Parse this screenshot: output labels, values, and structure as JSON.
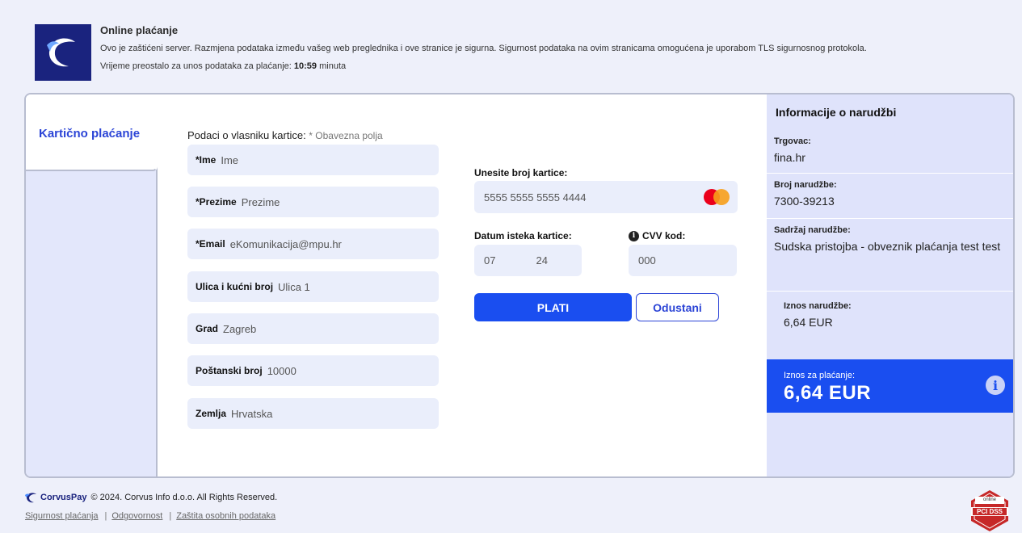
{
  "header": {
    "title": "Online plaćanje",
    "line1": "Ovo je zaštićeni server. Razmjena podataka između vašeg web preglednika i ove stranice je sigurna. Sigurnost podataka na ovim stranicama omogućena je uporabom TLS sigurnosnog protokola.",
    "time_prefix": "Vrijeme preostalo za unos podataka za plaćanje: ",
    "time_value": "10:59",
    "time_suffix": " minuta"
  },
  "tab": {
    "label": "Kartično plaćanje"
  },
  "owner": {
    "heading": "Podaci o vlasniku kartice: ",
    "required_note": "* Obavezna polja",
    "fields": [
      {
        "label": "*Ime",
        "value": "Ime"
      },
      {
        "label": "*Prezime",
        "value": "Prezime"
      },
      {
        "label": "*Email",
        "value": "eKomunikacija@mpu.hr"
      },
      {
        "label": "Ulica i kućni broj",
        "value": "Ulica 1"
      },
      {
        "label": "Grad",
        "value": "Zagreb"
      },
      {
        "label": "Poštanski broj",
        "value": "10000"
      },
      {
        "label": "Zemlja",
        "value": "Hrvatska"
      }
    ]
  },
  "card": {
    "number_label": "Unesite broj kartice:",
    "number_value": "5555 5555 5555 4444",
    "expiry_label": "Datum isteka kartice:",
    "expiry_month": "07",
    "expiry_year": "24",
    "cvv_label": "CVV kod:",
    "cvv_value": "000"
  },
  "actions": {
    "pay": "PLATI",
    "cancel": "Odustani"
  },
  "order": {
    "title": "Informacije o narudžbi",
    "merchant_label": "Trgovac:",
    "merchant_value": "fina.hr",
    "number_label": "Broj narudžbe:",
    "number_value": "7300-39213",
    "content_label": "Sadržaj narudžbe:",
    "content_value": "Sudska pristojba - obveznik plaćanja test test",
    "amount_label": "Iznos narudžbe:",
    "amount_value": "6,64 EUR",
    "pay_label": "Iznos za plaćanje:",
    "pay_value": "6,64 EUR"
  },
  "footer": {
    "brand": "CorvusPay",
    "copyright": "© 2024. Corvus Info d.o.o. All Rights Reserved.",
    "links": [
      "Sigurnost plaćanja",
      "Odgovornost",
      "Zaštita osobnih podataka"
    ],
    "pci_top": "online",
    "pci_text": "PCI DSS"
  },
  "colors": {
    "accent": "#1a4ef0",
    "brand": "#1a237e",
    "panel": "#dfe3fb"
  }
}
